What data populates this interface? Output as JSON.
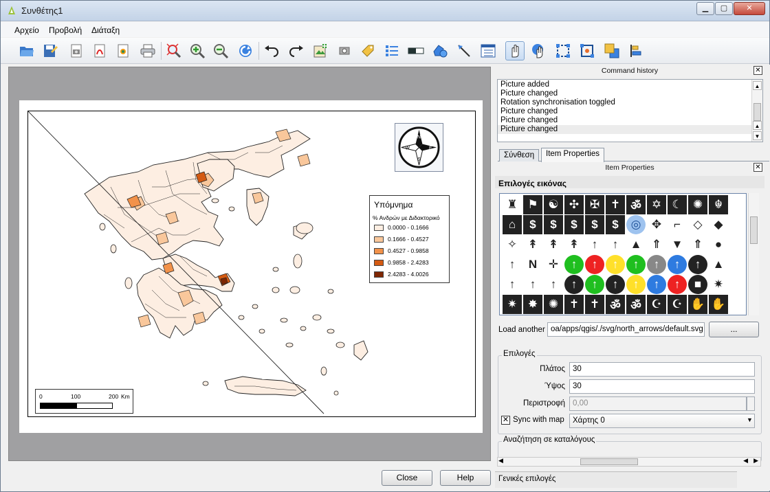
{
  "window": {
    "title": "Συνθέτης1"
  },
  "menu": [
    "Αρχείο",
    "Προβολή",
    "Διάταξη"
  ],
  "toolbar_icons": [
    "open-folder",
    "save-template",
    "export-image",
    "export-pdf",
    "export-svg",
    "print",
    "zoom-full",
    "zoom-in",
    "zoom-out",
    "refresh",
    "undo",
    "redo",
    "add-map",
    "add-image",
    "add-label",
    "add-legend",
    "add-scalebar",
    "add-shape",
    "add-arrow",
    "add-table",
    "select-move-item",
    "move-item-content",
    "group-items",
    "ungroup-items",
    "raise-items",
    "align-items"
  ],
  "map": {
    "legend": {
      "title": "Υπόμνημα",
      "subtitle": "% Ανδρών με Διδακτορικό",
      "classes": [
        {
          "label": "0.0000 - 0.1666",
          "color": "#fdeee2"
        },
        {
          "label": "0.1666 - 0.4527",
          "color": "#f9c79b"
        },
        {
          "label": "0.4527 - 0.9858",
          "color": "#f2924a"
        },
        {
          "label": "0.9858 - 2.4283",
          "color": "#d45a12"
        },
        {
          "label": "2.4283 - 4.0026",
          "color": "#7f2704"
        }
      ]
    },
    "scalebar": {
      "ticks": [
        "0",
        "100",
        "200"
      ],
      "unit": "Km"
    },
    "north_labels": [
      "N",
      "E",
      "S",
      "W"
    ]
  },
  "command_history": {
    "title": "Command history",
    "items": [
      "Picture added",
      "Picture changed",
      "Rotation synchronisation toggled",
      "Picture changed",
      "Picture changed",
      "Picture changed"
    ]
  },
  "tabs": [
    "Σύνθεση",
    "Item Properties"
  ],
  "item_properties": {
    "title": "Item Properties",
    "section_label": "Επιλογές εικόνας",
    "load_another_label": "Load another",
    "load_path": "oa/apps/qgis/./svg/north_arrows/default.svg",
    "browse_label": "...",
    "options_group": "Επιλογές",
    "width_label": "Πλάτος",
    "width_value": "30",
    "height_label": "Ύψος",
    "height_value": "30",
    "rotation_label": "Περιστροφή",
    "rotation_value": "0,00",
    "sync_label": "Sync with map",
    "sync_checked": true,
    "map_select": "Χάρτης 0",
    "search_group": "Αναζήτηση σε καταλόγους",
    "general_options": "Γενικές επιλογές"
  },
  "buttons": {
    "close": "Close",
    "help": "Help"
  }
}
